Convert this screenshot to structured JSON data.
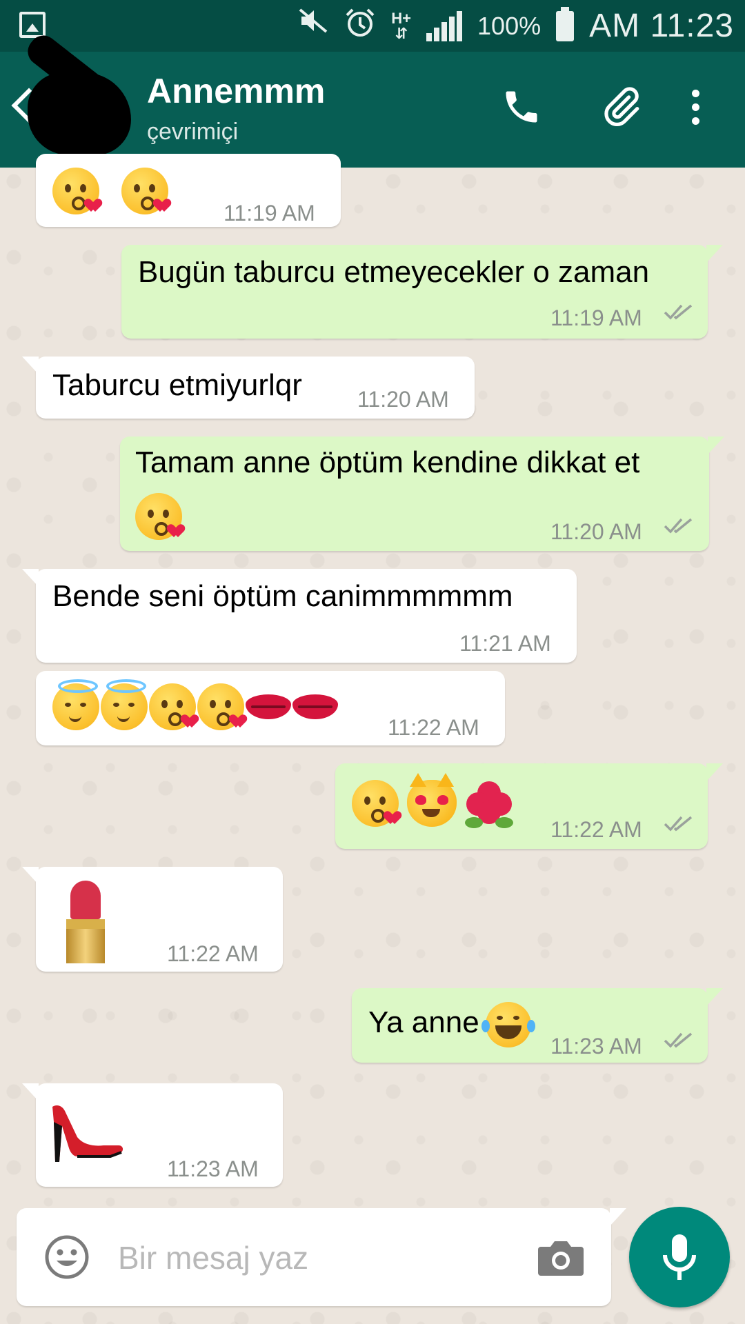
{
  "status_bar": {
    "battery": "100%",
    "time": "AM 11:23",
    "network": "H+"
  },
  "header": {
    "contact_name": "Annemmm",
    "contact_status": "çevrimiçi"
  },
  "messages": [
    {
      "direction": "in",
      "emojis": [
        "kissing-heart",
        "kissing-heart"
      ],
      "time": "11:19 AM"
    },
    {
      "direction": "out",
      "text": "Bugün taburcu etmeyecekler o zaman",
      "time": "11:19 AM",
      "read": true
    },
    {
      "direction": "in",
      "text": "Taburcu etmiyurlqr",
      "time": "11:20 AM"
    },
    {
      "direction": "out",
      "text": "Tamam anne öptüm kendine dikkat et",
      "emojis": [
        "kissing-heart"
      ],
      "time": "11:20 AM",
      "read": true
    },
    {
      "direction": "in",
      "text": "Bende seni öptüm canimmmmmm",
      "time": "11:21 AM"
    },
    {
      "direction": "in",
      "emojis": [
        "halo",
        "halo",
        "kissing-heart",
        "kissing-heart",
        "lips",
        "lips"
      ],
      "time": "11:22 AM"
    },
    {
      "direction": "out",
      "emojis": [
        "kissing-heart",
        "heart-eyes-cat",
        "hibiscus"
      ],
      "time": "11:22 AM",
      "read": true
    },
    {
      "direction": "in",
      "emojis": [
        "lipstick"
      ],
      "time": "11:22 AM"
    },
    {
      "direction": "out",
      "text": "Ya anne",
      "emojis": [
        "tears-of-joy"
      ],
      "time": "11:23 AM",
      "read": true
    },
    {
      "direction": "in",
      "emojis": [
        "high-heel"
      ],
      "time": "11:23 AM"
    }
  ],
  "composer": {
    "placeholder": "Bir mesaj yaz"
  },
  "colors": {
    "header": "#075e54",
    "status_bar": "#054d44",
    "outgoing_bubble": "#dcf8c6",
    "incoming_bubble": "#ffffff",
    "mic_button": "#00897b",
    "read_ticks": "#9aa19c"
  }
}
